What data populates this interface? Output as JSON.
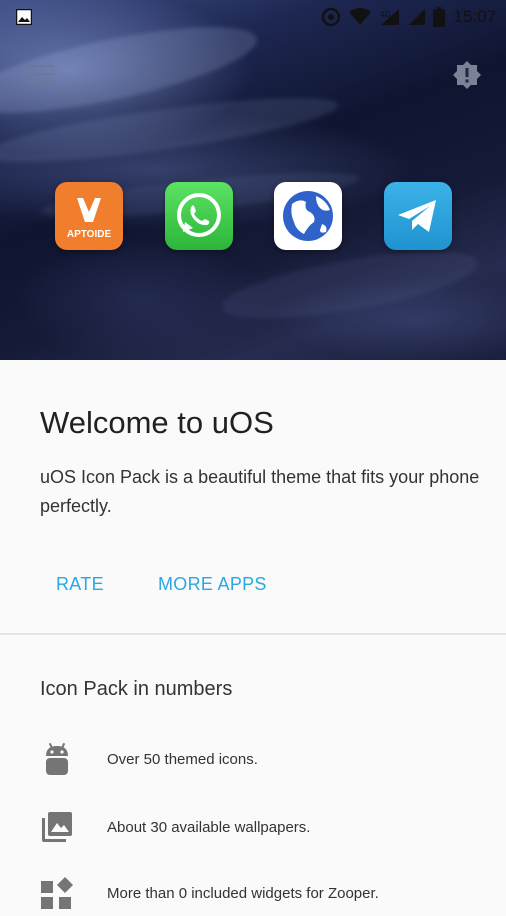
{
  "status_bar": {
    "time": "15:07",
    "notification_icon": "image-icon",
    "icons": [
      "sync-icon",
      "wifi-icon",
      "4g-signal-icon",
      "signal-icon",
      "battery-icon"
    ]
  },
  "header": {
    "menu_icon": "hamburger-menu-icon",
    "action_icon": "alert-badge-icon"
  },
  "hero": {
    "apps": [
      {
        "name": "Aptoide",
        "label": "APTOIDE",
        "color": "#f07e2c"
      },
      {
        "name": "WhatsApp",
        "color": "#3cc348"
      },
      {
        "name": "Browser",
        "color": "#ffffff"
      },
      {
        "name": "Telegram",
        "color": "#2aa3db"
      }
    ]
  },
  "welcome": {
    "title": "Welcome to uOS",
    "description": "uOS Icon Pack is a beautiful theme that fits your phone perfectly.",
    "rate_label": "RATE",
    "more_apps_label": "MORE APPS"
  },
  "numbers": {
    "title": "Icon Pack in numbers",
    "items": [
      {
        "icon": "android-icon",
        "text": "Over 50 themed icons."
      },
      {
        "icon": "wallpapers-icon",
        "text": "About 30 available wallpapers."
      },
      {
        "icon": "widgets-icon",
        "text": "More than 0 included widgets for Zooper."
      }
    ]
  },
  "colors": {
    "accent": "#2aa7e4",
    "background": "#fafafa",
    "text_primary": "#212121"
  }
}
